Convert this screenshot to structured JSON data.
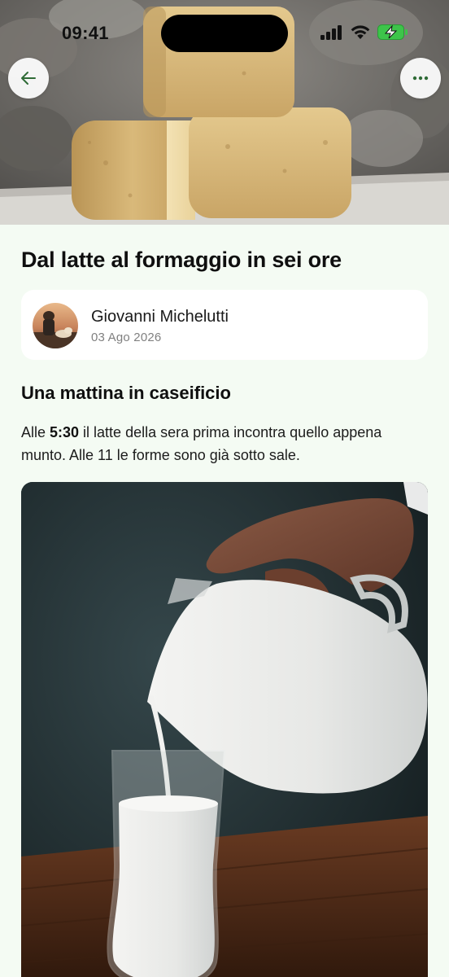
{
  "status_bar": {
    "time": "09:41"
  },
  "hero": {
    "icon": "cheese-photo"
  },
  "nav": {
    "back_icon": "arrow-left-icon",
    "more_icon": "more-dots-icon"
  },
  "article": {
    "title": "Dal latte al formaggio in sei ore",
    "author": {
      "name": "Giovanni Michelutti",
      "date": "03 Ago 2026"
    },
    "section_title": "Una mattina in caseificio",
    "paragraph": {
      "prefix": "Alle ",
      "highlight": "5:30",
      "suffix": " il latte della sera prima incontra quello appena munto. Alle 11 le forme sono già sotto sale."
    }
  },
  "colors": {
    "background": "#f4fbf3",
    "card": "#ffffff",
    "battery": "#3dc44a"
  }
}
